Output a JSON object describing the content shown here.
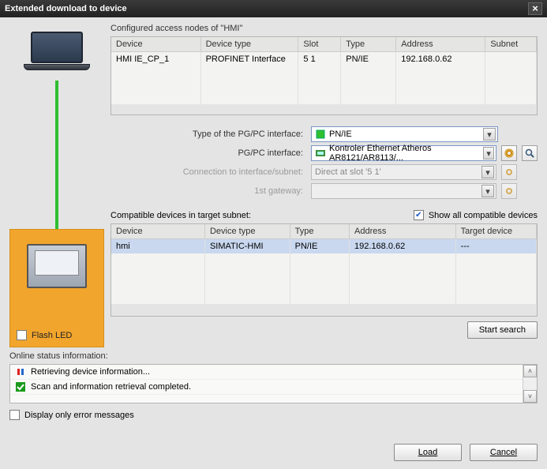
{
  "title": "Extended download to device",
  "configured_label": "Configured access nodes of \"HMI\"",
  "table1": {
    "headers": [
      "Device",
      "Device type",
      "Slot",
      "Type",
      "Address",
      "Subnet"
    ],
    "rows": [
      {
        "device": "HMI IE_CP_1",
        "devtype": "PROFINET Interface",
        "slot": "5 1",
        "type": "PN/IE",
        "address": "192.168.0.62",
        "subnet": ""
      }
    ]
  },
  "form": {
    "pg_type_label": "Type of the PG/PC interface:",
    "pg_type_value": "PN/IE",
    "pg_if_label": "PG/PC interface:",
    "pg_if_value": "Kontroler Ethernet Atheros AR8121/AR8113/...",
    "conn_label": "Connection to interface/subnet:",
    "conn_value": "Direct at slot '5 1'",
    "gw_label": "1st gateway:",
    "gw_value": ""
  },
  "compat_label": "Compatible devices in target subnet:",
  "show_all_label": "Show all compatible devices",
  "show_all_checked": true,
  "table2": {
    "headers": [
      "Device",
      "Device type",
      "Type",
      "Address",
      "Target device"
    ],
    "rows": [
      {
        "device": "hmi",
        "devtype": "SIMATIC-HMI",
        "type": "PN/IE",
        "address": "192.168.0.62",
        "target": "---"
      }
    ]
  },
  "flash_led_label": "Flash LED",
  "start_search_label": "Start search",
  "status_label": "Online status information:",
  "status_rows": [
    {
      "icon": "busy",
      "text": "Retrieving device information..."
    },
    {
      "icon": "ok",
      "text": "Scan and information retrieval completed."
    }
  ],
  "only_errors_label": "Display only error messages",
  "load_label": "Load",
  "cancel_label": "Cancel"
}
